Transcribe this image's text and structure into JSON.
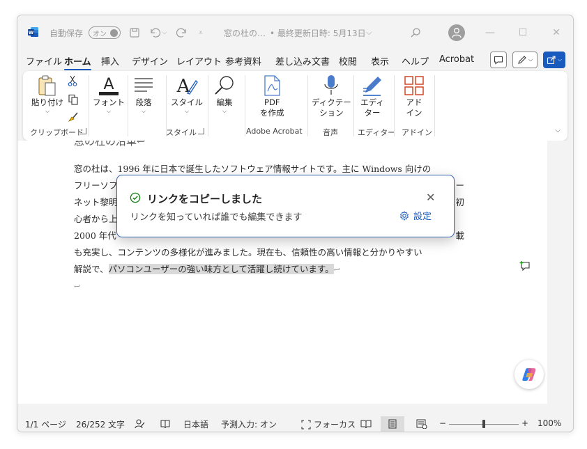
{
  "titlebar": {
    "autosave_label": "自動保存",
    "autosave_toggle": "オン",
    "doc_title": "窓の杜の…",
    "last_modified": "• 最終更新日時: 5月13日",
    "title_chevron": "⌵"
  },
  "menu": {
    "tabs": [
      "ファイル",
      "ホーム",
      "挿入",
      "デザイン",
      "レイアウト",
      "参考資料",
      "差し込み文書",
      "校閲",
      "表示",
      "ヘルプ",
      "Acrobat"
    ],
    "active_tab": "ホーム"
  },
  "ribbon": {
    "paste_label": "貼り付け",
    "font_label": "フォント",
    "paragraph_label": "段落",
    "styles_label": "スタイル",
    "editing_label": "編集",
    "pdf_label_1": "PDF",
    "pdf_label_2": "を作成",
    "dictate_label_1": "ディクテー",
    "dictate_label_2": "ション",
    "editor_label_1": "エディ",
    "editor_label_2": "ター",
    "addin_label_1": "アド",
    "addin_label_2": "イン",
    "groups": {
      "clipboard": "クリップボード",
      "style": "スタイル",
      "acrobat": "Adobe Acrobat",
      "voice": "音声",
      "editor": "エディター",
      "addin": "アドイン"
    }
  },
  "document": {
    "heading_partial": "窓の杜の沿革↩",
    "lines": [
      "窓の杜は、1996 年に日本で誕生したソフトウェア情報サイトです。主に Windows 向けの",
      "フリーソフ",
      "ネット黎明",
      "心者から上",
      "2000 年代",
      "も充実し、コンテンツの多様化が進みました。現在も、信頼性の高い情報と分かりやすい",
      "解説で、"
    ],
    "line2_right": "ー",
    "line3_right": "初",
    "line5_right": "載",
    "highlighted": "パソコンユーザーの強い味方として活躍し続けています。",
    "para_mark": "↩"
  },
  "toast": {
    "title": "リンクをコピーしました",
    "message": "リンクを知っていれば誰でも編集できます",
    "settings_label": "設定"
  },
  "status": {
    "page": "1/1 ページ",
    "words": "26/252 文字",
    "language": "日本語",
    "prediction": "予測入力: オン",
    "focus": "フォーカス",
    "zoom_minus": "−",
    "zoom_plus": "+",
    "zoom": "100%",
    "zoom_level": 1.0
  },
  "colors": {
    "accent": "#185abd",
    "highlight": "#d9d9d9"
  }
}
